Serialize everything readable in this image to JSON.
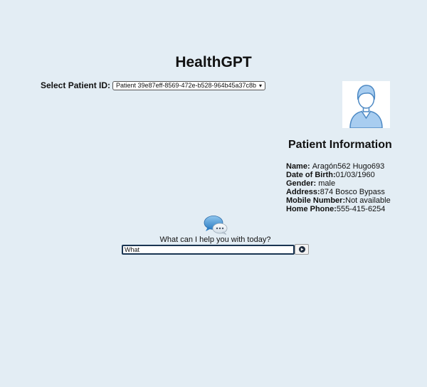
{
  "app": {
    "title": "HealthGPT"
  },
  "patient_select": {
    "label": "Select Patient ID:",
    "selected_value": "Patient 39e87eff-8569-472e-b528-964b45a37c8b"
  },
  "patient_info": {
    "heading": "Patient Information",
    "rows": [
      {
        "label": "Name",
        "sep": ": ",
        "value": "Aragón562 Hugo693"
      },
      {
        "label": "Date of Birth",
        "sep": ":",
        "value": "01/03/1960"
      },
      {
        "label": "Gender",
        "sep": ": ",
        "value": "male"
      },
      {
        "label": "Address",
        "sep": ":",
        "value": "874 Bosco Bypass"
      },
      {
        "label": "Mobile Number",
        "sep": ":",
        "value": "Not available"
      },
      {
        "label": "Home Phone",
        "sep": ":",
        "value": "555-415-6254"
      }
    ]
  },
  "chat": {
    "prompt": "What can I help you with today?",
    "input_value": "What",
    "send_icon": "play-circle-icon"
  },
  "icons": {
    "avatar": "user-avatar-icon",
    "chat": "chat-bubbles-icon"
  },
  "colors": {
    "background": "#e3edf4",
    "input_border": "#1a3552",
    "avatar_fill": "#a8cdf0",
    "avatar_stroke": "#4d89c4"
  }
}
